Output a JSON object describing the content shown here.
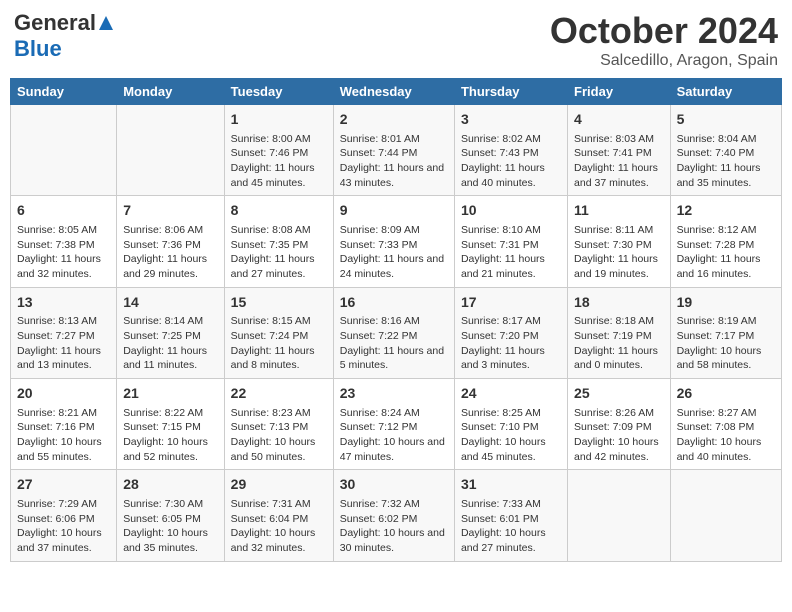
{
  "logo": {
    "general": "General",
    "blue": "Blue"
  },
  "title": "October 2024",
  "subtitle": "Salcedillo, Aragon, Spain",
  "headers": [
    "Sunday",
    "Monday",
    "Tuesday",
    "Wednesday",
    "Thursday",
    "Friday",
    "Saturday"
  ],
  "weeks": [
    [
      {
        "day": "",
        "info": ""
      },
      {
        "day": "",
        "info": ""
      },
      {
        "day": "1",
        "info": "Sunrise: 8:00 AM\nSunset: 7:46 PM\nDaylight: 11 hours and 45 minutes."
      },
      {
        "day": "2",
        "info": "Sunrise: 8:01 AM\nSunset: 7:44 PM\nDaylight: 11 hours and 43 minutes."
      },
      {
        "day": "3",
        "info": "Sunrise: 8:02 AM\nSunset: 7:43 PM\nDaylight: 11 hours and 40 minutes."
      },
      {
        "day": "4",
        "info": "Sunrise: 8:03 AM\nSunset: 7:41 PM\nDaylight: 11 hours and 37 minutes."
      },
      {
        "day": "5",
        "info": "Sunrise: 8:04 AM\nSunset: 7:40 PM\nDaylight: 11 hours and 35 minutes."
      }
    ],
    [
      {
        "day": "6",
        "info": "Sunrise: 8:05 AM\nSunset: 7:38 PM\nDaylight: 11 hours and 32 minutes."
      },
      {
        "day": "7",
        "info": "Sunrise: 8:06 AM\nSunset: 7:36 PM\nDaylight: 11 hours and 29 minutes."
      },
      {
        "day": "8",
        "info": "Sunrise: 8:08 AM\nSunset: 7:35 PM\nDaylight: 11 hours and 27 minutes."
      },
      {
        "day": "9",
        "info": "Sunrise: 8:09 AM\nSunset: 7:33 PM\nDaylight: 11 hours and 24 minutes."
      },
      {
        "day": "10",
        "info": "Sunrise: 8:10 AM\nSunset: 7:31 PM\nDaylight: 11 hours and 21 minutes."
      },
      {
        "day": "11",
        "info": "Sunrise: 8:11 AM\nSunset: 7:30 PM\nDaylight: 11 hours and 19 minutes."
      },
      {
        "day": "12",
        "info": "Sunrise: 8:12 AM\nSunset: 7:28 PM\nDaylight: 11 hours and 16 minutes."
      }
    ],
    [
      {
        "day": "13",
        "info": "Sunrise: 8:13 AM\nSunset: 7:27 PM\nDaylight: 11 hours and 13 minutes."
      },
      {
        "day": "14",
        "info": "Sunrise: 8:14 AM\nSunset: 7:25 PM\nDaylight: 11 hours and 11 minutes."
      },
      {
        "day": "15",
        "info": "Sunrise: 8:15 AM\nSunset: 7:24 PM\nDaylight: 11 hours and 8 minutes."
      },
      {
        "day": "16",
        "info": "Sunrise: 8:16 AM\nSunset: 7:22 PM\nDaylight: 11 hours and 5 minutes."
      },
      {
        "day": "17",
        "info": "Sunrise: 8:17 AM\nSunset: 7:20 PM\nDaylight: 11 hours and 3 minutes."
      },
      {
        "day": "18",
        "info": "Sunrise: 8:18 AM\nSunset: 7:19 PM\nDaylight: 11 hours and 0 minutes."
      },
      {
        "day": "19",
        "info": "Sunrise: 8:19 AM\nSunset: 7:17 PM\nDaylight: 10 hours and 58 minutes."
      }
    ],
    [
      {
        "day": "20",
        "info": "Sunrise: 8:21 AM\nSunset: 7:16 PM\nDaylight: 10 hours and 55 minutes."
      },
      {
        "day": "21",
        "info": "Sunrise: 8:22 AM\nSunset: 7:15 PM\nDaylight: 10 hours and 52 minutes."
      },
      {
        "day": "22",
        "info": "Sunrise: 8:23 AM\nSunset: 7:13 PM\nDaylight: 10 hours and 50 minutes."
      },
      {
        "day": "23",
        "info": "Sunrise: 8:24 AM\nSunset: 7:12 PM\nDaylight: 10 hours and 47 minutes."
      },
      {
        "day": "24",
        "info": "Sunrise: 8:25 AM\nSunset: 7:10 PM\nDaylight: 10 hours and 45 minutes."
      },
      {
        "day": "25",
        "info": "Sunrise: 8:26 AM\nSunset: 7:09 PM\nDaylight: 10 hours and 42 minutes."
      },
      {
        "day": "26",
        "info": "Sunrise: 8:27 AM\nSunset: 7:08 PM\nDaylight: 10 hours and 40 minutes."
      }
    ],
    [
      {
        "day": "27",
        "info": "Sunrise: 7:29 AM\nSunset: 6:06 PM\nDaylight: 10 hours and 37 minutes."
      },
      {
        "day": "28",
        "info": "Sunrise: 7:30 AM\nSunset: 6:05 PM\nDaylight: 10 hours and 35 minutes."
      },
      {
        "day": "29",
        "info": "Sunrise: 7:31 AM\nSunset: 6:04 PM\nDaylight: 10 hours and 32 minutes."
      },
      {
        "day": "30",
        "info": "Sunrise: 7:32 AM\nSunset: 6:02 PM\nDaylight: 10 hours and 30 minutes."
      },
      {
        "day": "31",
        "info": "Sunrise: 7:33 AM\nSunset: 6:01 PM\nDaylight: 10 hours and 27 minutes."
      },
      {
        "day": "",
        "info": ""
      },
      {
        "day": "",
        "info": ""
      }
    ]
  ]
}
